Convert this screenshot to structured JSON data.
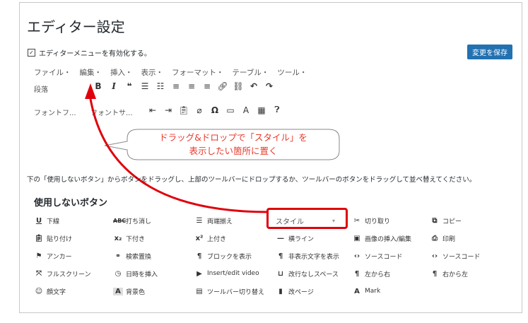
{
  "page": {
    "title": "エディター設定",
    "save_label": "変更を保存"
  },
  "checkbox": {
    "checked": true,
    "label": "エディターメニューを有効化する。"
  },
  "menubar": [
    "ファイル・",
    "編集・",
    "挿入・",
    "表示・",
    "フォーマット・",
    "テーブル・",
    "ツール・"
  ],
  "toolbar": {
    "format_select": "段落",
    "font_family_select": "フォントフ...",
    "font_size_select": "フォントサ..."
  },
  "callout": {
    "line1": "ドラッグ&ドロップで「スタイル」を",
    "line2": "表示したい箇所に置く"
  },
  "instructions": "下の「使用しないボタン」からボタンをドラッグし、上部のツールバーにドロップするか、ツールバーのボタンをドラッグして並べ替えてください。",
  "unused": {
    "heading": "使用しないボタン",
    "buttons": [
      {
        "icon": "underline-icon",
        "label": "下線"
      },
      {
        "icon": "strikethrough-icon",
        "label": "打ち消し"
      },
      {
        "icon": "align-justify-icon",
        "label": "両端揃え"
      },
      {
        "icon": "",
        "label": "スタイル"
      },
      {
        "icon": "scissors-icon",
        "label": "切り取り"
      },
      {
        "icon": "copy-icon",
        "label": "コピー"
      },
      {
        "icon": "paste-icon",
        "label": "貼り付け"
      },
      {
        "icon": "subscript-icon",
        "label": "下付き"
      },
      {
        "icon": "superscript-icon",
        "label": "上付き"
      },
      {
        "icon": "horizontal-line-icon",
        "label": "横ライン"
      },
      {
        "icon": "image-icon",
        "label": "画像の挿入/編集"
      },
      {
        "icon": "print-icon",
        "label": "印刷"
      },
      {
        "icon": "anchor-icon",
        "label": "アンカー"
      },
      {
        "icon": "search-replace-icon",
        "label": "検索置換"
      },
      {
        "icon": "paragraph-icon",
        "label": "ブロックを表示"
      },
      {
        "icon": "paragraph-icon",
        "label": "非表示文字を表示"
      },
      {
        "icon": "code-icon",
        "label": "ソースコード"
      },
      {
        "icon": "code-icon",
        "label": "ソースコード"
      },
      {
        "icon": "fullscreen-icon",
        "label": "フルスクリーン"
      },
      {
        "icon": "clock-icon",
        "label": "日時を挿入"
      },
      {
        "icon": "video-icon",
        "label": "Insert/edit video"
      },
      {
        "icon": "nbsp-icon",
        "label": "改行なしスペース"
      },
      {
        "icon": "ltr-icon",
        "label": "左から右"
      },
      {
        "icon": "rtl-icon",
        "label": "右から左"
      },
      {
        "icon": "emoji-icon",
        "label": "顔文字"
      },
      {
        "icon": "bg-color-icon",
        "label": "背景色"
      },
      {
        "icon": "toolbar-toggle-icon",
        "label": "ツールバー切り替え"
      },
      {
        "icon": "pagebreak-icon",
        "label": "改ページ"
      },
      {
        "icon": "mark-icon",
        "label": "Mark"
      }
    ]
  }
}
